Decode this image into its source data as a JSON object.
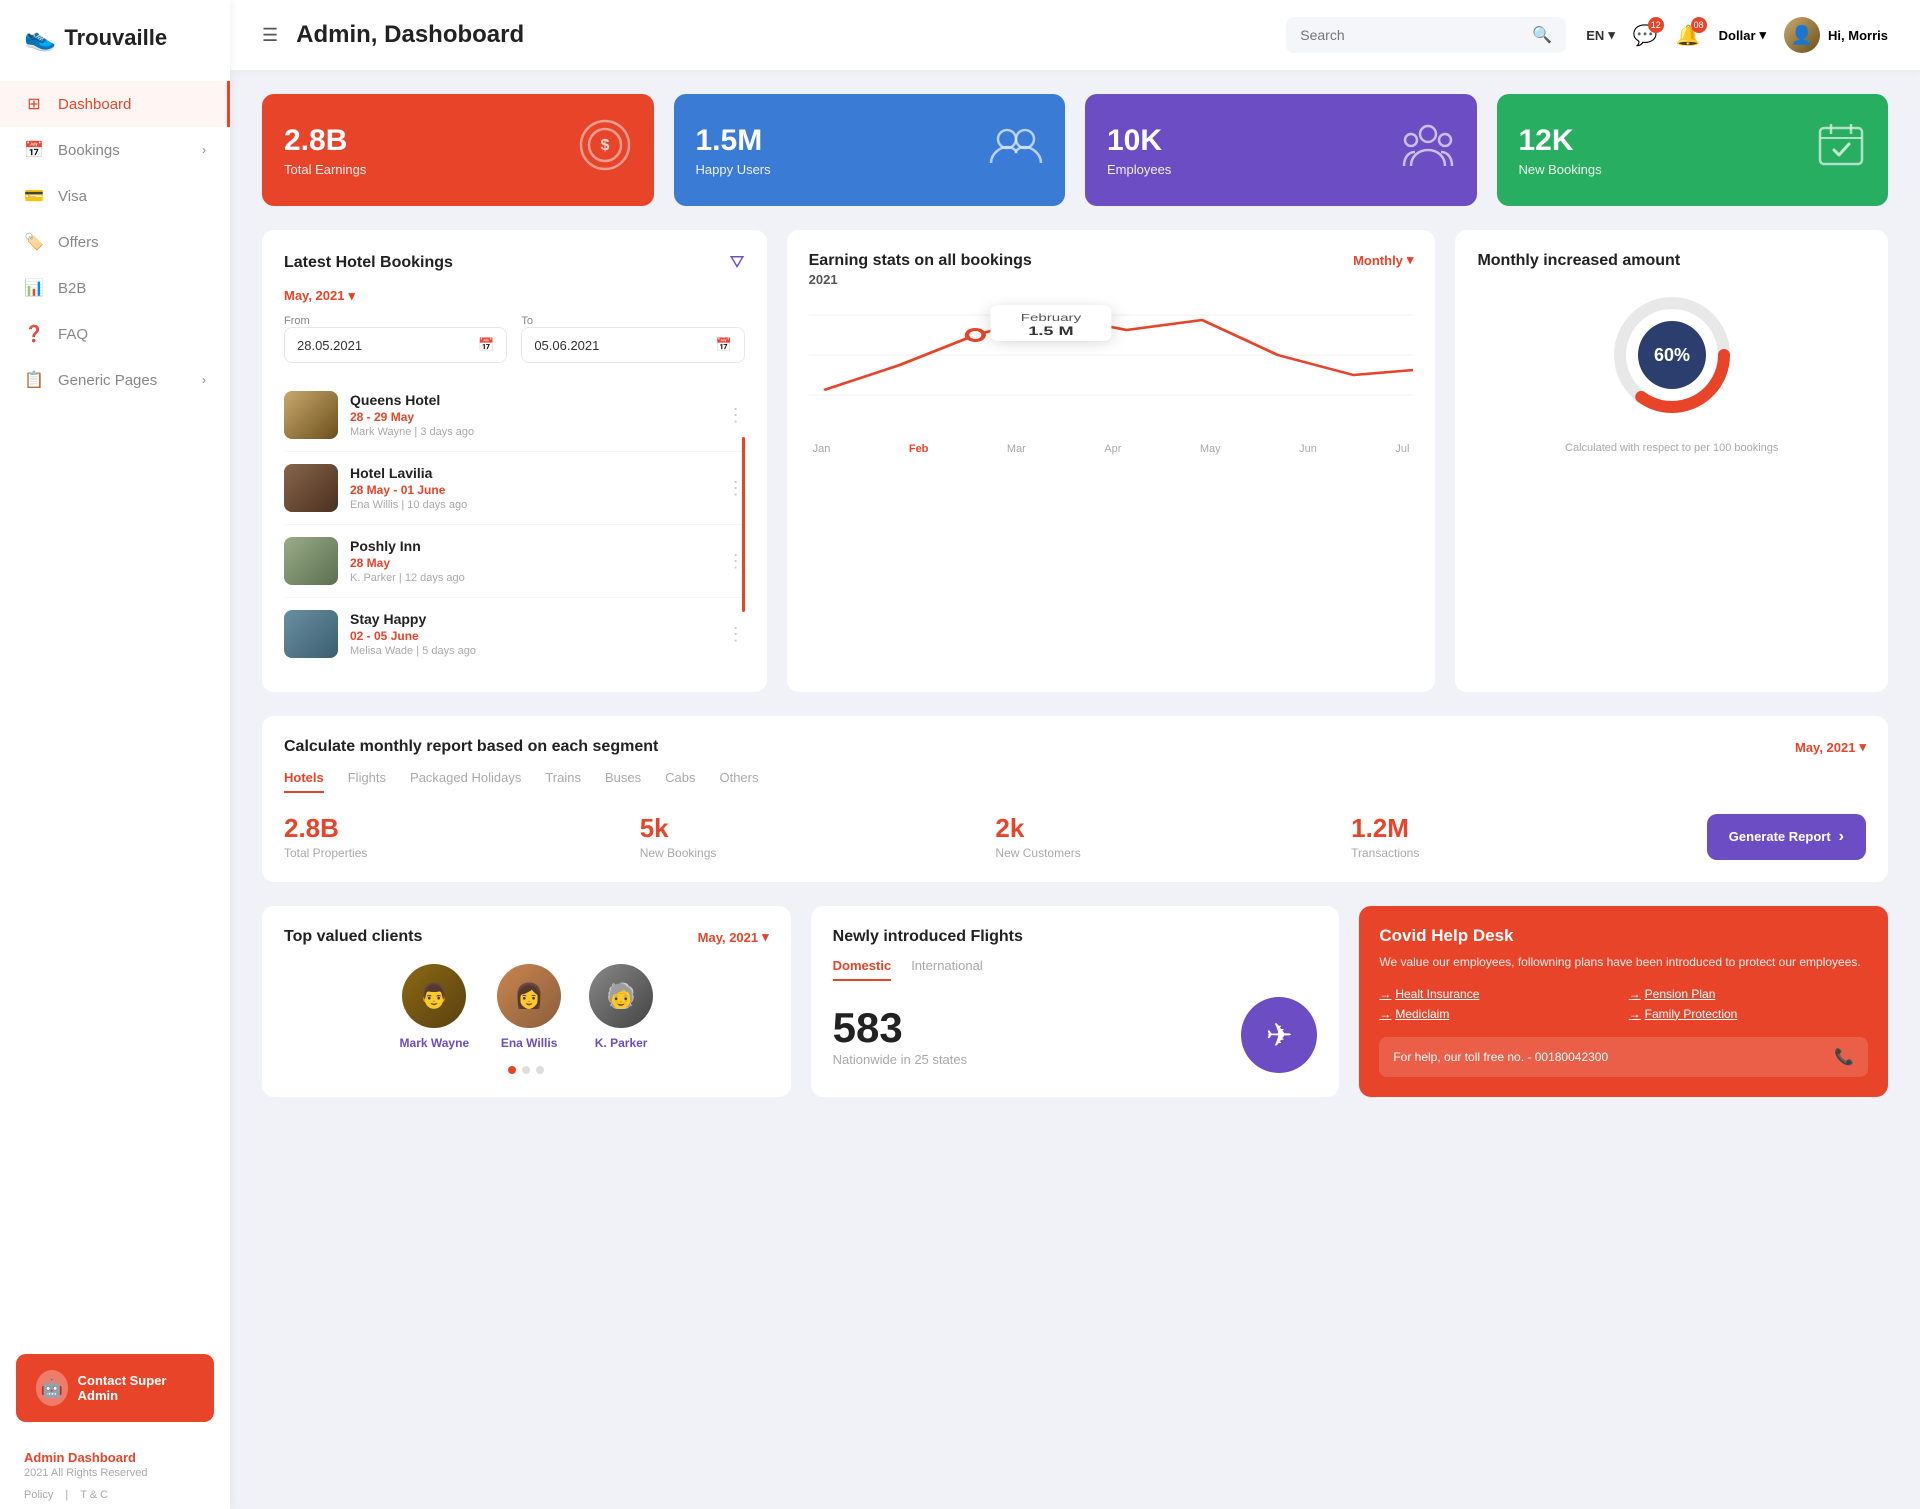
{
  "sidebar": {
    "logo": "Trouvaille",
    "nav": [
      {
        "id": "dashboard",
        "label": "Dashboard",
        "icon": "⊞",
        "active": true
      },
      {
        "id": "bookings",
        "label": "Bookings",
        "icon": "📅",
        "hasChevron": true
      },
      {
        "id": "visa",
        "label": "Visa",
        "icon": "💳"
      },
      {
        "id": "offers",
        "label": "Offers",
        "icon": "🏷️"
      },
      {
        "id": "b2b",
        "label": "B2B",
        "icon": "📊"
      },
      {
        "id": "faq",
        "label": "FAQ",
        "icon": "❓"
      },
      {
        "id": "generic",
        "label": "Generic Pages",
        "icon": "📋",
        "hasChevron": true
      }
    ],
    "contact_label": "Contact Super Admin",
    "footer": {
      "title": "Admin Dashboard",
      "subtitle": "2021 All Rights Reserved",
      "links": [
        "Policy",
        "|",
        "T & C"
      ]
    }
  },
  "header": {
    "title": "Admin, Dashoboard",
    "search_placeholder": "Search",
    "lang": "EN",
    "messages_badge": "12",
    "notifications_badge": "08",
    "currency": "Dollar",
    "user_greeting": "Hi, Morris"
  },
  "stats": [
    {
      "value": "2.8B",
      "label": "Total Earnings",
      "color": "card-red",
      "icon": "💰"
    },
    {
      "value": "1.5M",
      "label": "Happy Users",
      "color": "card-blue",
      "icon": "👥"
    },
    {
      "value": "10K",
      "label": "Employees",
      "color": "card-purple",
      "icon": "👨‍👩‍👧"
    },
    {
      "value": "12K",
      "label": "New Bookings",
      "color": "card-green",
      "icon": "📋"
    }
  ],
  "hotel_bookings": {
    "title": "Latest Hotel Bookings",
    "date_filter": "May, 2021",
    "from_label": "From",
    "to_label": "To",
    "from_date": "28.05.2021",
    "to_date": "05.06.2021",
    "bookings": [
      {
        "name": "Queens Hotel",
        "dates": "28 - 29 May",
        "user": "Mark Wayne",
        "ago": "3 days ago",
        "color": "#c9a96e"
      },
      {
        "name": "Hotel Lavilia",
        "dates": "28 May - 01 June",
        "user": "Ena Willis",
        "ago": "10 days ago",
        "color": "#87654a"
      },
      {
        "name": "Poshly Inn",
        "dates": "28 May",
        "user": "K. Parker",
        "ago": "12 days ago",
        "color": "#9aab87"
      },
      {
        "name": "Stay Happy",
        "dates": "02 - 05 June",
        "user": "Melisa Wade",
        "ago": "5 days ago",
        "color": "#6a8fa0"
      }
    ]
  },
  "earning_stats": {
    "title": "Earning stats on all bookings",
    "year": "2021",
    "period": "Monthly",
    "tooltip_month": "February",
    "tooltip_value": "1.5 M",
    "months": [
      "Jan",
      "Feb",
      "Mar",
      "Apr",
      "May",
      "Jun",
      "Jul"
    ],
    "active_month": "Feb"
  },
  "monthly_amount": {
    "title": "Monthly increased amount",
    "percent": "60%",
    "subtitle": "Calculated with respect to per 100 bookings"
  },
  "segment": {
    "title": "Calculate monthly report based on each segment",
    "date": "May, 2021",
    "tabs": [
      "Hotels",
      "Flights",
      "Packaged Holidays",
      "Trains",
      "Buses",
      "Cabs",
      "Others"
    ],
    "active_tab": "Hotels",
    "stats": [
      {
        "value": "2.8B",
        "label": "Total Properties"
      },
      {
        "value": "5k",
        "label": "New Bookings"
      },
      {
        "value": "2k",
        "label": "New Customers"
      },
      {
        "value": "1.2M",
        "label": "Transactions"
      }
    ],
    "generate_btn": "Generate Report"
  },
  "top_clients": {
    "title": "Top valued clients",
    "date": "May, 2021",
    "clients": [
      {
        "name": "Mark Wayne"
      },
      {
        "name": "Ena Willis"
      },
      {
        "name": "K. Parker"
      }
    ],
    "dots": [
      true,
      false,
      false
    ]
  },
  "flights": {
    "title": "Newly introduced Flights",
    "tabs": [
      "Domestic",
      "International"
    ],
    "active_tab": "Domestic",
    "count": "583",
    "label": "Nationwide in 25 states"
  },
  "covid": {
    "title": "Covid Help Desk",
    "description": "We value our employees, followning plans have been introduced to protect our employees.",
    "links": [
      "Healt Insurance",
      "Pension Plan",
      "Mediclaim",
      "Family Protection"
    ],
    "phone_text": "For help, our toll free no. - 00180042300"
  }
}
